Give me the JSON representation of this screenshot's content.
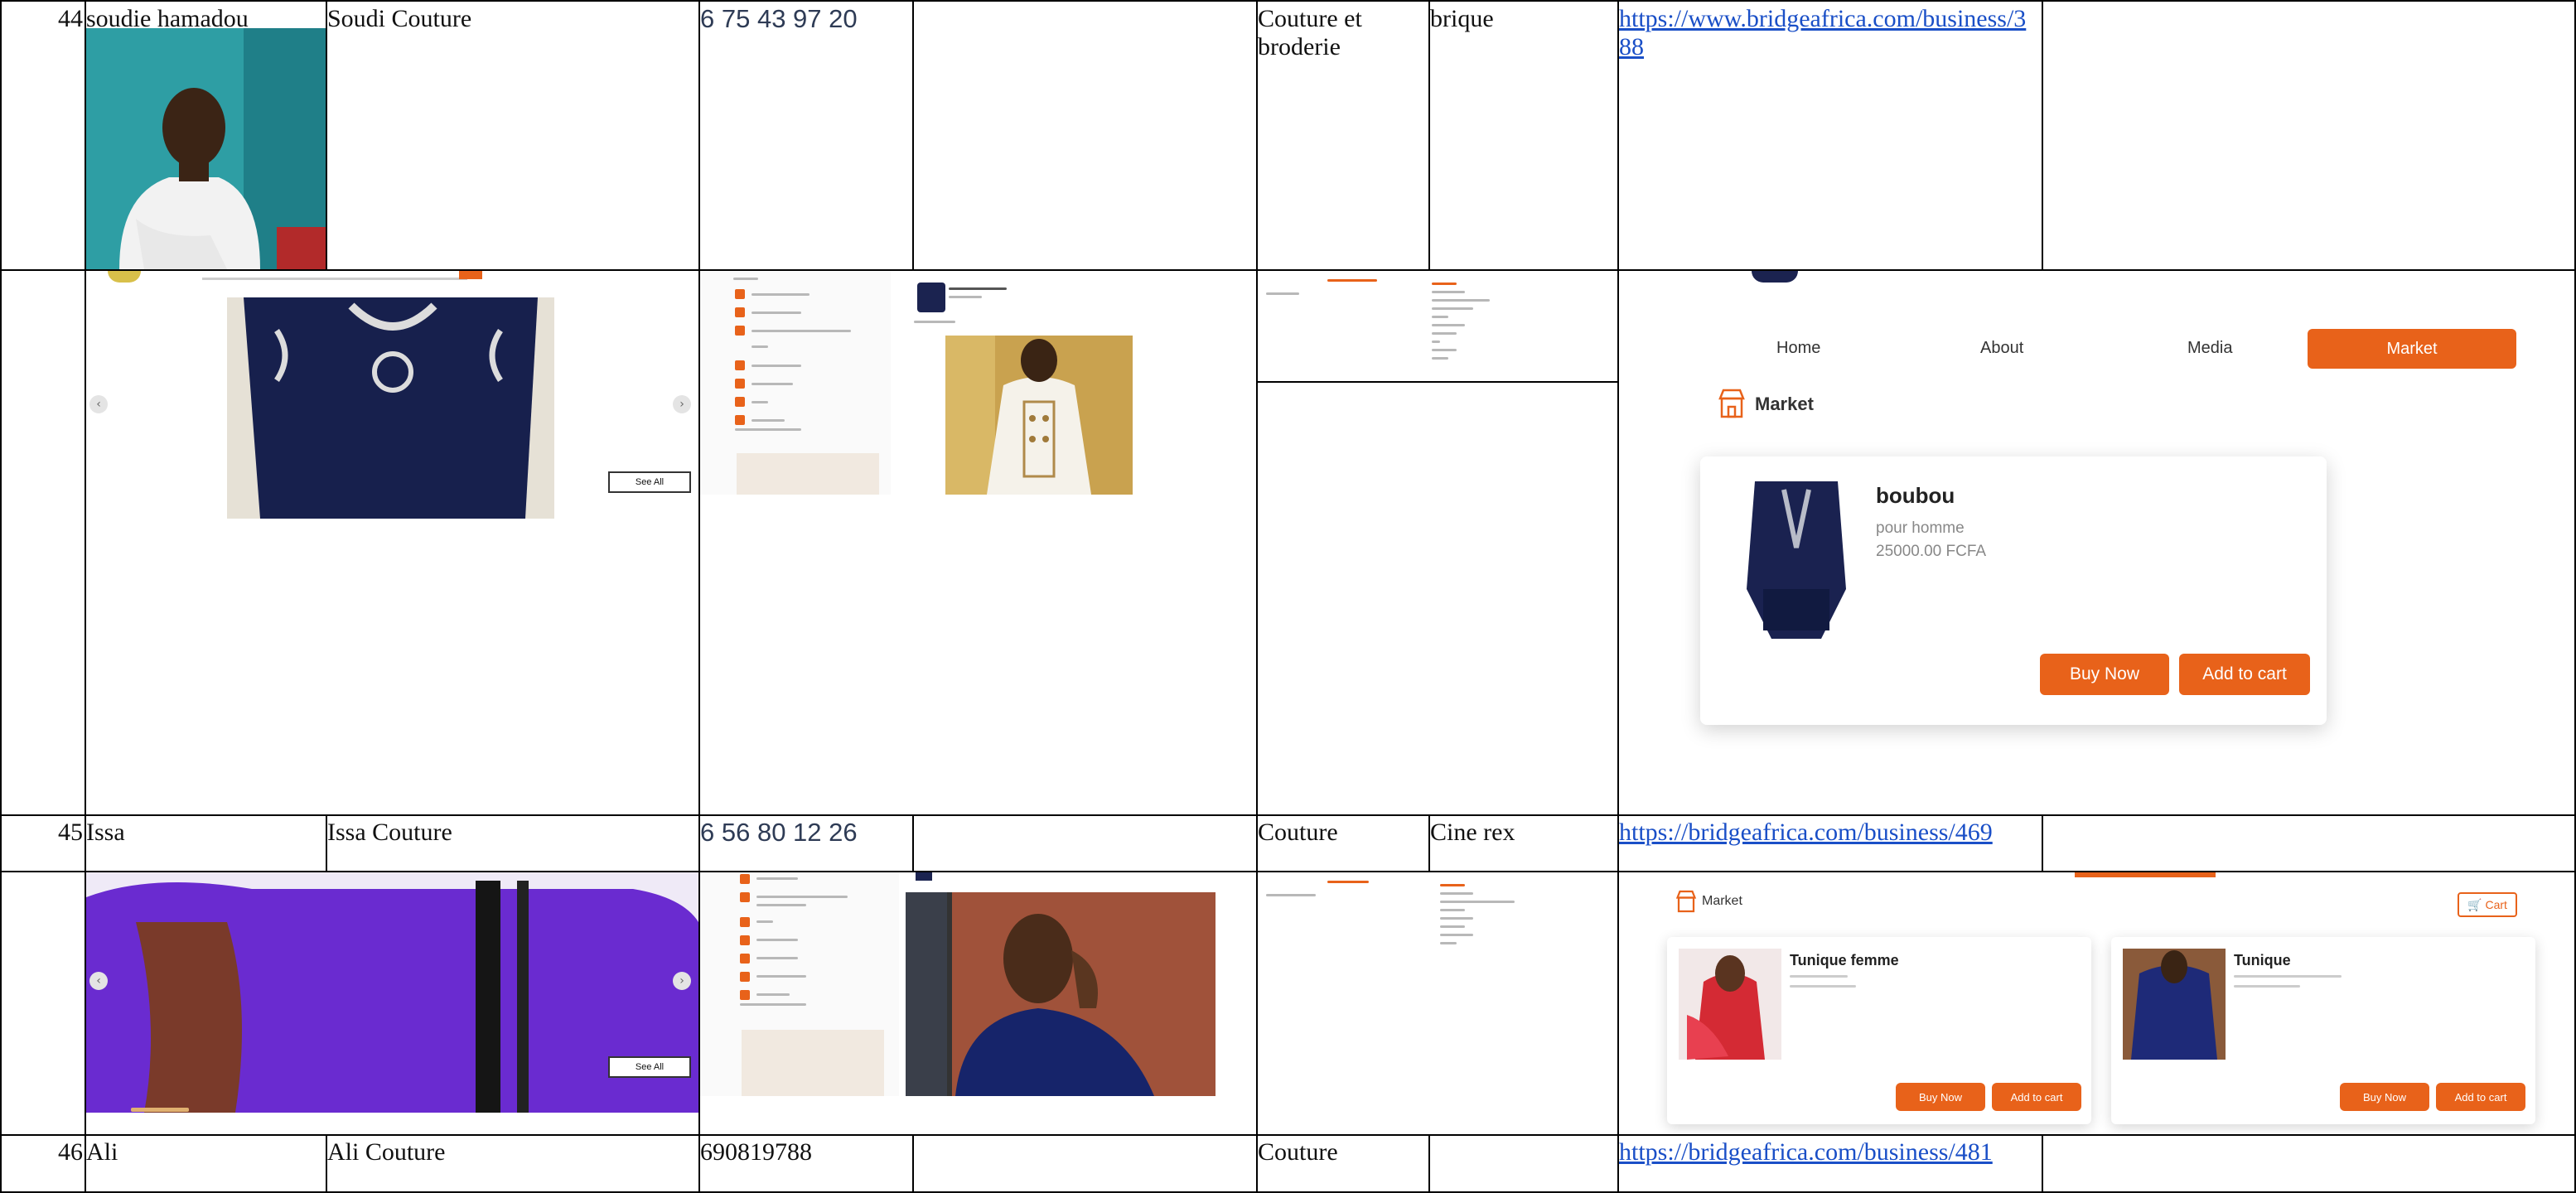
{
  "rows": [
    {
      "num": "44",
      "name": "soudie hamadou",
      "business": "Soudi Couture",
      "phone": "6 75 43 97 20",
      "category": "Couture et broderie",
      "location": "brique",
      "url": "https://www.bridgeafrica.com/business/388"
    },
    {
      "num": "45",
      "name": "Issa",
      "business": "Issa Couture",
      "phone": "6 56 80 12 26",
      "category": "Couture",
      "location": "Cine rex",
      "url": "https://bridgeafrica.com/business/469"
    },
    {
      "num": "46",
      "name": "Ali",
      "business": "Ali Couture",
      "phone": "690819788",
      "category": "Couture",
      "location": "",
      "url": "https://bridgeafrica.com/business/481"
    }
  ],
  "shot1_nav": {
    "home": "Home",
    "about": "About",
    "media": "Media",
    "market": "Market",
    "section_title": "Market"
  },
  "shot1_product": {
    "name": "boubou",
    "desc": "pour homme",
    "price": "25000.00 FCFA",
    "buy": "Buy Now",
    "cart": "Add to cart"
  },
  "shot2_market": {
    "title": "Market",
    "cart": "Cart",
    "products": [
      {
        "name": "Tunique femme",
        "buy": "Buy Now",
        "cart": "Add to cart"
      },
      {
        "name": "Tunique",
        "buy": "Buy Now",
        "cart": "Add to cart"
      }
    ]
  },
  "carousel": {
    "see_all": "See All"
  },
  "colors": {
    "accent": "#e8621a",
    "link": "#1a4fc7",
    "navy": "#15204a",
    "purple": "#6a2bd0"
  },
  "icons": [
    "prev-arrow-icon",
    "next-arrow-icon",
    "market-store-icon",
    "cart-icon"
  ]
}
